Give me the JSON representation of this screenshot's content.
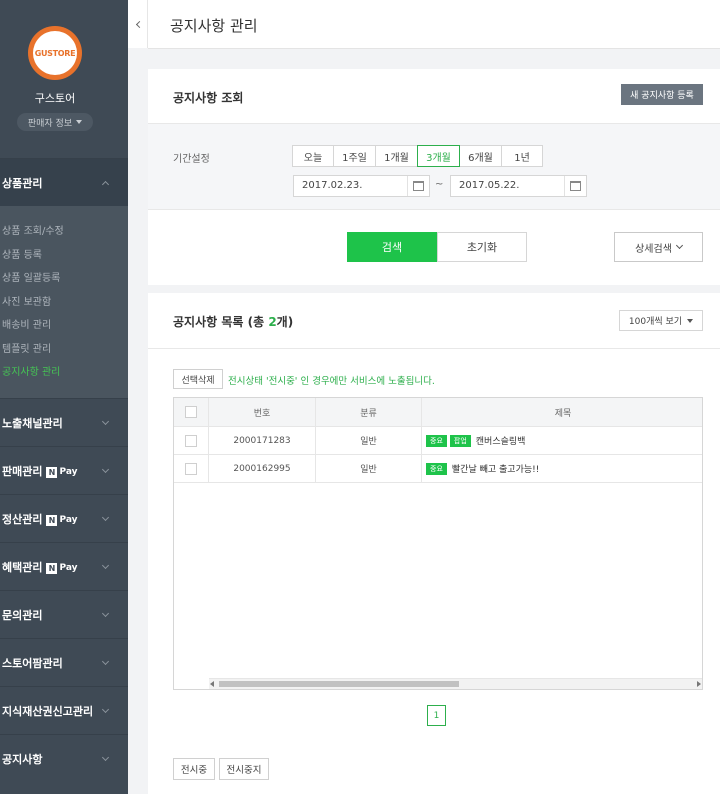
{
  "sidebar": {
    "logo_text": "GUSTORE",
    "store_name": "구스토어",
    "seller_info_label": "판매자 정보",
    "groups": [
      {
        "label": "상품관리",
        "expanded": true,
        "npay": false
      },
      {
        "label": "노출채널관리",
        "expanded": false,
        "npay": false
      },
      {
        "label": "판매관리",
        "expanded": false,
        "npay": true
      },
      {
        "label": "정산관리",
        "expanded": false,
        "npay": true
      },
      {
        "label": "혜택관리",
        "expanded": false,
        "npay": true
      },
      {
        "label": "문의관리",
        "expanded": false,
        "npay": false
      },
      {
        "label": "스토어팜관리",
        "expanded": false,
        "npay": false
      },
      {
        "label": "지식재산권신고관리",
        "expanded": false,
        "npay": false
      },
      {
        "label": "공지사항",
        "expanded": false,
        "npay": false
      }
    ],
    "npay_label": "Pay",
    "npay_n": "N",
    "submenu": [
      {
        "label": "상품 조회/수정",
        "active": false
      },
      {
        "label": "상품 등록",
        "active": false
      },
      {
        "label": "상품 일괄등록",
        "active": false
      },
      {
        "label": "사진 보관함",
        "active": false
      },
      {
        "label": "배송비 관리",
        "active": false
      },
      {
        "label": "템플릿 관리",
        "active": false
      },
      {
        "label": "공지사항 관리",
        "active": true
      }
    ]
  },
  "header": {
    "title": "공지사항 관리"
  },
  "search_panel": {
    "title": "공지사항 조회",
    "new_button": "새 공지사항 등록",
    "period_label": "기간설정",
    "period_options": [
      "오늘",
      "1주일",
      "1개월",
      "3개월",
      "6개월",
      "1년"
    ],
    "period_selected": "3개월",
    "date_from": "2017.02.23.",
    "date_to": "2017.05.22.",
    "date_sep": "~",
    "search_button": "검색",
    "reset_button": "초기화",
    "detail_button": "상세검색"
  },
  "list_panel": {
    "title_prefix": "공지사항 목록 (총 ",
    "count": "2",
    "title_suffix": "개)",
    "per_page": "100개씩 보기",
    "select_delete": "선택삭제",
    "notice_message": "전시상태 '전시중' 인 경우에만 서비스에 노출됩니다.",
    "columns": [
      "번호",
      "분류",
      "제목"
    ],
    "rows": [
      {
        "number": "2000171283",
        "category": "일반",
        "tags": [
          "중요",
          "팝업"
        ],
        "title": "캔버스슬링백"
      },
      {
        "number": "2000162995",
        "category": "일반",
        "tags": [
          "중요"
        ],
        "title": "빨간날 빼고 출고가능!!"
      }
    ],
    "page": "1",
    "footer_buttons": [
      "전시중",
      "전시중지"
    ]
  },
  "colors": {
    "accent": "#1ec34a",
    "sidebar_bg": "#3f4a55",
    "active_menu": "#45c554"
  }
}
